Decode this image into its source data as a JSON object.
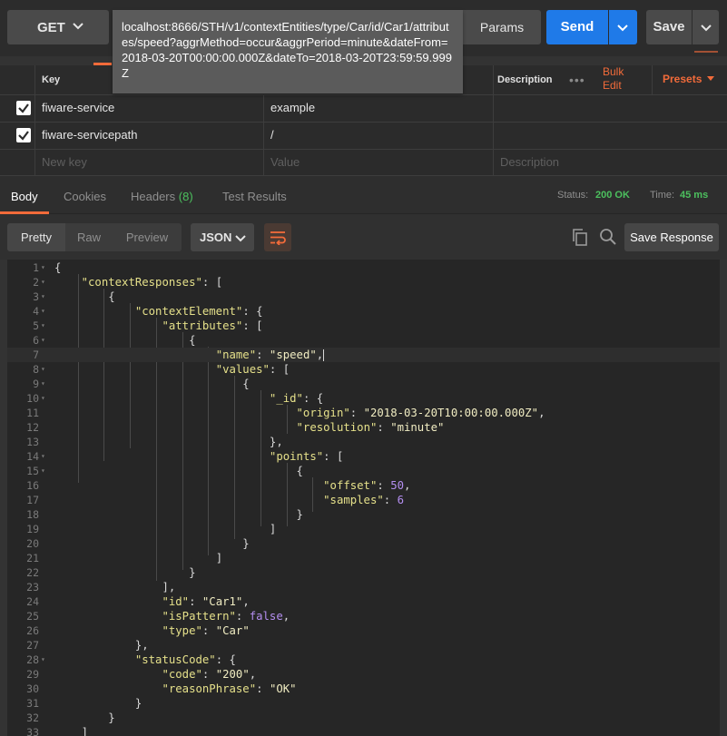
{
  "request": {
    "method": "GET",
    "url": "localhost:8666/STH/v1/contextEntities/type/Car/id/Car1/attributes/speed?aggrMethod=occur&aggrPeriod=minute&dateFrom=2018-03-20T00:00:00.000Z&dateTo=2018-03-20T23:59:59.999Z",
    "params_label": "Params",
    "send_label": "Send",
    "save_label": "Save"
  },
  "headers_table": {
    "columns": {
      "key": "Key",
      "value": "Value",
      "description": "Description"
    },
    "more": "•••",
    "bulk_edit": "Bulk Edit",
    "presets": "Presets",
    "rows": [
      {
        "key": "fiware-service",
        "value": "example",
        "checked": true
      },
      {
        "key": "fiware-servicepath",
        "value": "/",
        "checked": true
      }
    ],
    "placeholders": {
      "key": "New key",
      "value": "Value",
      "description": "Description"
    }
  },
  "response_tabs": {
    "body": "Body",
    "cookies": "Cookies",
    "headers": "Headers",
    "headers_count": "(8)",
    "test_results": "Test Results",
    "status_label": "Status:",
    "status_value": "200 OK",
    "time_label": "Time:",
    "time_value": "45 ms"
  },
  "view_toolbar": {
    "pretty": "Pretty",
    "raw": "Raw",
    "preview": "Preview",
    "format": "JSON",
    "save_response": "Save Response"
  },
  "icons": {
    "method_dropdown": "chevron-down-icon",
    "send_dropdown": "chevron-down-icon",
    "save_dropdown": "chevron-down-icon",
    "checkbox": "checkmark-icon",
    "format_dropdown": "chevron-down-icon",
    "wrap": "wrap-lines-icon",
    "copy": "copy-icon",
    "search": "search-icon"
  },
  "colors": {
    "accent_orange": "#f26b3a",
    "send_blue": "#1f7ae8",
    "status_green": "#4cc05e",
    "json_key": "#e5e08a",
    "json_string": "#f0ecc2",
    "json_number": "#b48ef0"
  },
  "code_lines": [
    {
      "n": "1",
      "fold": true,
      "html": "<span class=\"p\">{</span>"
    },
    {
      "n": "2",
      "fold": true,
      "html": "    <span class=\"k\">\"contextResponses\"</span><span class=\"p\">: [</span>"
    },
    {
      "n": "3",
      "fold": true,
      "html": "        <span class=\"p\">{</span>"
    },
    {
      "n": "4",
      "fold": true,
      "html": "            <span class=\"k\">\"contextElement\"</span><span class=\"p\">: {</span>"
    },
    {
      "n": "5",
      "fold": true,
      "html": "                <span class=\"k\">\"attributes\"</span><span class=\"p\">: [</span>"
    },
    {
      "n": "6",
      "fold": true,
      "html": "                    <span class=\"p\">{</span>"
    },
    {
      "n": "7",
      "fold": false,
      "active": true,
      "html": "                        <span class=\"k\">\"name\"</span><span class=\"p\">: </span><span class=\"s\">\"speed\"</span><span class=\"p\">,</span><span class=\"caret\"></span>"
    },
    {
      "n": "8",
      "fold": true,
      "html": "                        <span class=\"k\">\"values\"</span><span class=\"p\">: [</span>"
    },
    {
      "n": "9",
      "fold": true,
      "html": "                            <span class=\"p\">{</span>"
    },
    {
      "n": "10",
      "fold": true,
      "html": "                                <span class=\"k\">\"_id\"</span><span class=\"p\">: {</span>"
    },
    {
      "n": "11",
      "fold": false,
      "html": "                                    <span class=\"k\">\"origin\"</span><span class=\"p\">: </span><span class=\"s\">\"2018-03-20T10:00:00.000Z\"</span><span class=\"p\">,</span>"
    },
    {
      "n": "12",
      "fold": false,
      "html": "                                    <span class=\"k\">\"resolution\"</span><span class=\"p\">: </span><span class=\"s\">\"minute\"</span>"
    },
    {
      "n": "13",
      "fold": false,
      "html": "                                <span class=\"p\">},</span>"
    },
    {
      "n": "14",
      "fold": true,
      "html": "                                <span class=\"k\">\"points\"</span><span class=\"p\">: [</span>"
    },
    {
      "n": "15",
      "fold": true,
      "html": "                                    <span class=\"p\">{</span>"
    },
    {
      "n": "16",
      "fold": false,
      "html": "                                        <span class=\"k\">\"offset\"</span><span class=\"p\">: </span><span class=\"n\">50</span><span class=\"p\">,</span>"
    },
    {
      "n": "17",
      "fold": false,
      "html": "                                        <span class=\"k\">\"samples\"</span><span class=\"p\">: </span><span class=\"n\">6</span>"
    },
    {
      "n": "18",
      "fold": false,
      "html": "                                    <span class=\"p\">}</span>"
    },
    {
      "n": "19",
      "fold": false,
      "html": "                                <span class=\"p\">]</span>"
    },
    {
      "n": "20",
      "fold": false,
      "html": "                            <span class=\"p\">}</span>"
    },
    {
      "n": "21",
      "fold": false,
      "html": "                        <span class=\"p\">]</span>"
    },
    {
      "n": "22",
      "fold": false,
      "html": "                    <span class=\"p\">}</span>"
    },
    {
      "n": "23",
      "fold": false,
      "html": "                <span class=\"p\">],</span>"
    },
    {
      "n": "24",
      "fold": false,
      "html": "                <span class=\"k\">\"id\"</span><span class=\"p\">: </span><span class=\"s\">\"Car1\"</span><span class=\"p\">,</span>"
    },
    {
      "n": "25",
      "fold": false,
      "html": "                <span class=\"k\">\"isPattern\"</span><span class=\"p\">: </span><span class=\"b\">false</span><span class=\"p\">,</span>"
    },
    {
      "n": "26",
      "fold": false,
      "html": "                <span class=\"k\">\"type\"</span><span class=\"p\">: </span><span class=\"s\">\"Car\"</span>"
    },
    {
      "n": "27",
      "fold": false,
      "html": "            <span class=\"p\">},</span>"
    },
    {
      "n": "28",
      "fold": true,
      "html": "            <span class=\"k\">\"statusCode\"</span><span class=\"p\">: {</span>"
    },
    {
      "n": "29",
      "fold": false,
      "html": "                <span class=\"k\">\"code\"</span><span class=\"p\">: </span><span class=\"s\">\"200\"</span><span class=\"p\">,</span>"
    },
    {
      "n": "30",
      "fold": false,
      "html": "                <span class=\"k\">\"reasonPhrase\"</span><span class=\"p\">: </span><span class=\"s\">\"OK\"</span>"
    },
    {
      "n": "31",
      "fold": false,
      "html": "            <span class=\"p\">}</span>"
    },
    {
      "n": "32",
      "fold": false,
      "html": "        <span class=\"p\">}</span>"
    },
    {
      "n": "33",
      "fold": false,
      "html": "    <span class=\"p\">]</span>"
    }
  ]
}
